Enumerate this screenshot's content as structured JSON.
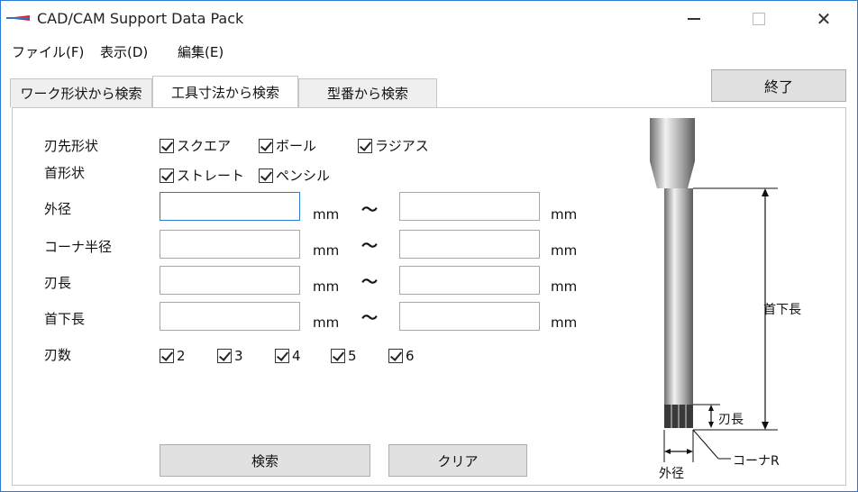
{
  "window": {
    "title": "CAD/CAM Support Data Pack"
  },
  "menu": {
    "items": [
      "ファイル(F)",
      "表示(D)",
      "編集(E)"
    ]
  },
  "tabs": [
    "ワーク形状から検索",
    "工具寸法から検索",
    "型番から検索"
  ],
  "exit_label": "終了",
  "form": {
    "blade_shape_label": "刃先形状",
    "blade_shapes": [
      "スクエア",
      "ボール",
      "ラジアス"
    ],
    "neck_shape_label": "首形状",
    "neck_shapes": [
      "ストレート",
      "ペンシル"
    ],
    "ranges": [
      {
        "label": "外径",
        "min": "",
        "max": ""
      },
      {
        "label": "コーナ半径",
        "min": "",
        "max": ""
      },
      {
        "label": "刃長",
        "min": "",
        "max": ""
      },
      {
        "label": "首下長",
        "min": "",
        "max": ""
      }
    ],
    "unit": "mm",
    "tilde": "〜",
    "flutes_label": "刃数",
    "flutes": [
      "2",
      "3",
      "4",
      "5",
      "6"
    ],
    "search_label": "検索",
    "clear_label": "クリア"
  },
  "diagram": {
    "neck_length": "首下長",
    "blade_length": "刃長",
    "corner_r": "コーナR",
    "outer_diameter": "外径"
  },
  "colors": {
    "accent": "#2b7bd6",
    "button": "#e1e1e1"
  }
}
